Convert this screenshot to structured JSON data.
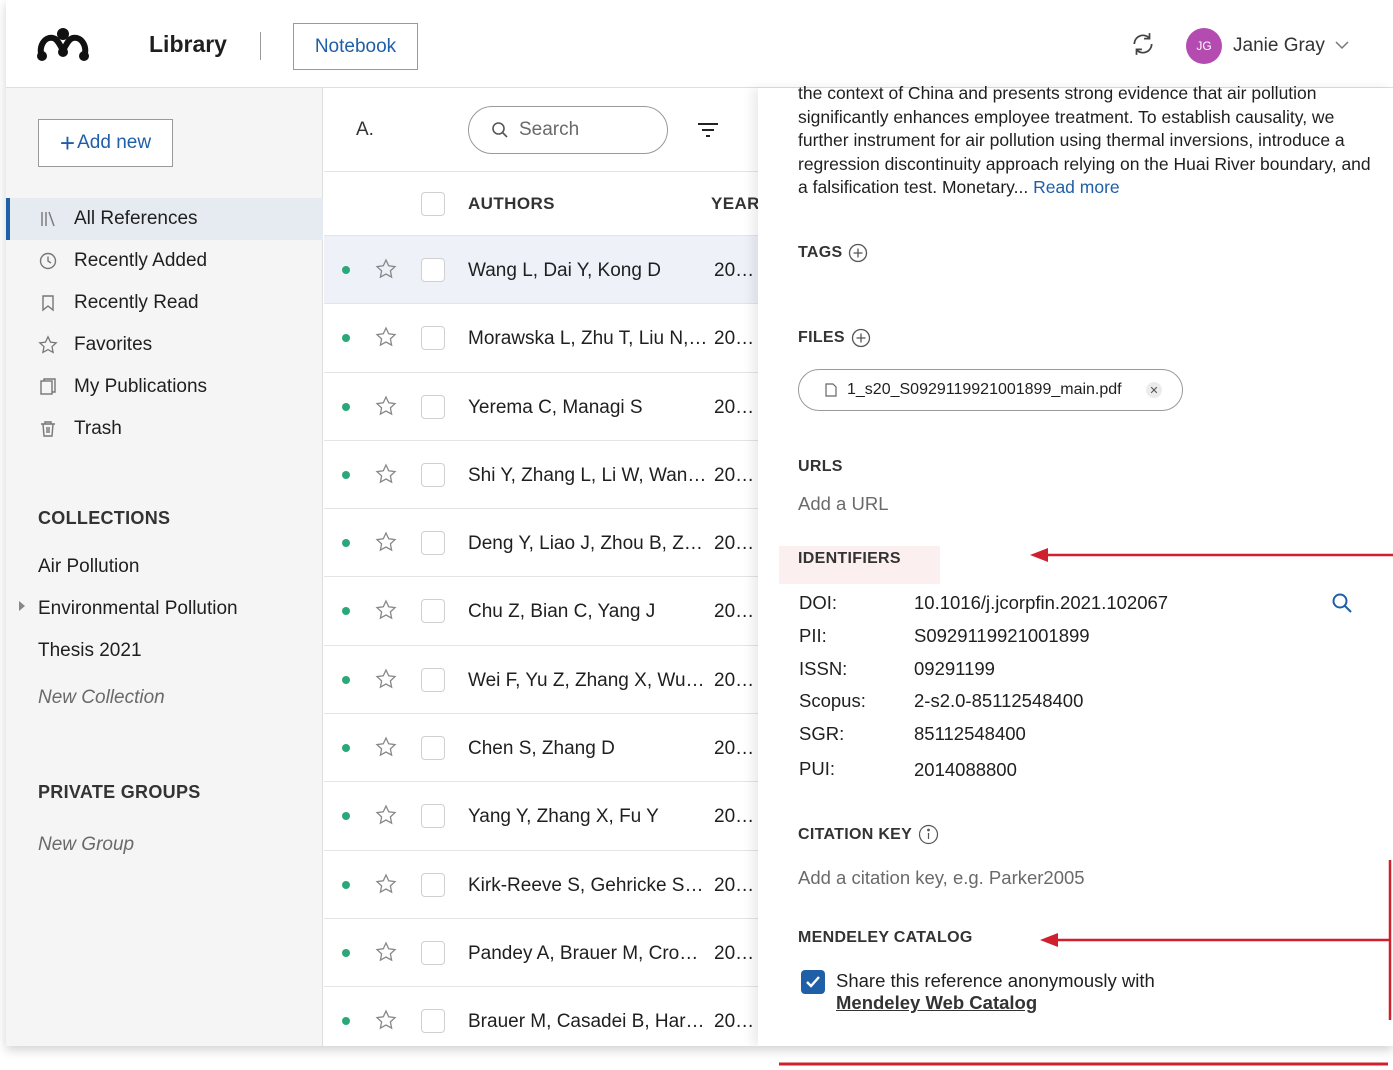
{
  "header": {
    "app_title": "Library",
    "notebook_label": "Notebook",
    "user_initials": "JG",
    "user_name": "Janie Gray"
  },
  "sidebar": {
    "add_new_label": "Add new",
    "nav": [
      {
        "label": "All References",
        "icon": "library-icon",
        "active": true
      },
      {
        "label": "Recently Added",
        "icon": "clock-icon"
      },
      {
        "label": "Recently Read",
        "icon": "bookmark-icon"
      },
      {
        "label": "Favorites",
        "icon": "star-icon"
      },
      {
        "label": "My Publications",
        "icon": "publications-icon"
      },
      {
        "label": "Trash",
        "icon": "trash-icon"
      }
    ],
    "collections_title": "COLLECTIONS",
    "collections": [
      "Air Pollution",
      "Environmental Pollution",
      "Thesis 2021"
    ],
    "new_collection": "New Collection",
    "groups_title": "PRIVATE GROUPS",
    "new_group": "New Group"
  },
  "list": {
    "letter": "A.",
    "search_placeholder": "Search",
    "col_authors": "AUTHORS",
    "col_year": "YEAR",
    "rows": [
      {
        "authors": "Wang L, Dai Y, Kong D",
        "year": "20…"
      },
      {
        "authors": "Morawska L, Zhu T, Liu N,…",
        "year": "20…"
      },
      {
        "authors": "Yerema C, Managi S",
        "year": "20…"
      },
      {
        "authors": "Shi Y, Zhang L, Li W, Wan…",
        "year": "20…"
      },
      {
        "authors": "Deng Y, Liao J, Zhou B, Z…",
        "year": "20…"
      },
      {
        "authors": "Chu Z, Bian C, Yang J",
        "year": "20…"
      },
      {
        "authors": "Wei F, Yu Z, Zhang X, Wu …",
        "year": "20…"
      },
      {
        "authors": "Chen S, Zhang D",
        "year": "20…"
      },
      {
        "authors": "Yang Y, Zhang X, Fu Y",
        "year": "20…"
      },
      {
        "authors": "Kirk-Reeve S, Gehricke S,…",
        "year": "20…"
      },
      {
        "authors": "Pandey A, Brauer M, Crop…",
        "year": "20…"
      },
      {
        "authors": "Brauer M, Casadei B, Har…",
        "year": "20…"
      }
    ]
  },
  "details": {
    "abstract": "the context of China and presents strong evidence that air pollution significantly enhances employee treatment. To establish causality, we further instrument for air pollution using thermal inversions, introduce a regression discontinuity approach relying on the Huai River boundary, and a falsification test. Monetary...",
    "read_more": "Read more",
    "tags_label": "TAGS",
    "files_label": "FILES",
    "file_name": "1_s20_S0929119921001899_main.pdf",
    "urls_label": "URLS",
    "url_placeholder": "Add a URL",
    "identifiers_label": "IDENTIFIERS",
    "identifiers": [
      {
        "key": "DOI:",
        "value": "10.1016/j.jcorpfin.2021.102067"
      },
      {
        "key": "PII:",
        "value": "S0929119921001899"
      },
      {
        "key": "ISSN:",
        "value": "09291199"
      },
      {
        "key": "Scopus:",
        "value": "2-s2.0-85112548400"
      },
      {
        "key": "SGR:",
        "value": "85112548400"
      },
      {
        "key": "PUI:",
        "value": "2014088800"
      }
    ],
    "citation_label": "CITATION KEY",
    "citation_placeholder": "Add a citation key, e.g. Parker2005",
    "catalog_label": "MENDELEY CATALOG",
    "share_text": "Share this reference anonymously with",
    "share_link": "Mendeley Web Catalog",
    "share_checked": true
  },
  "colors": {
    "accent": "#1f5fa8",
    "avatar": "#b44bb0",
    "read_dot": "#2aa879",
    "annotation": "#d0202e"
  }
}
